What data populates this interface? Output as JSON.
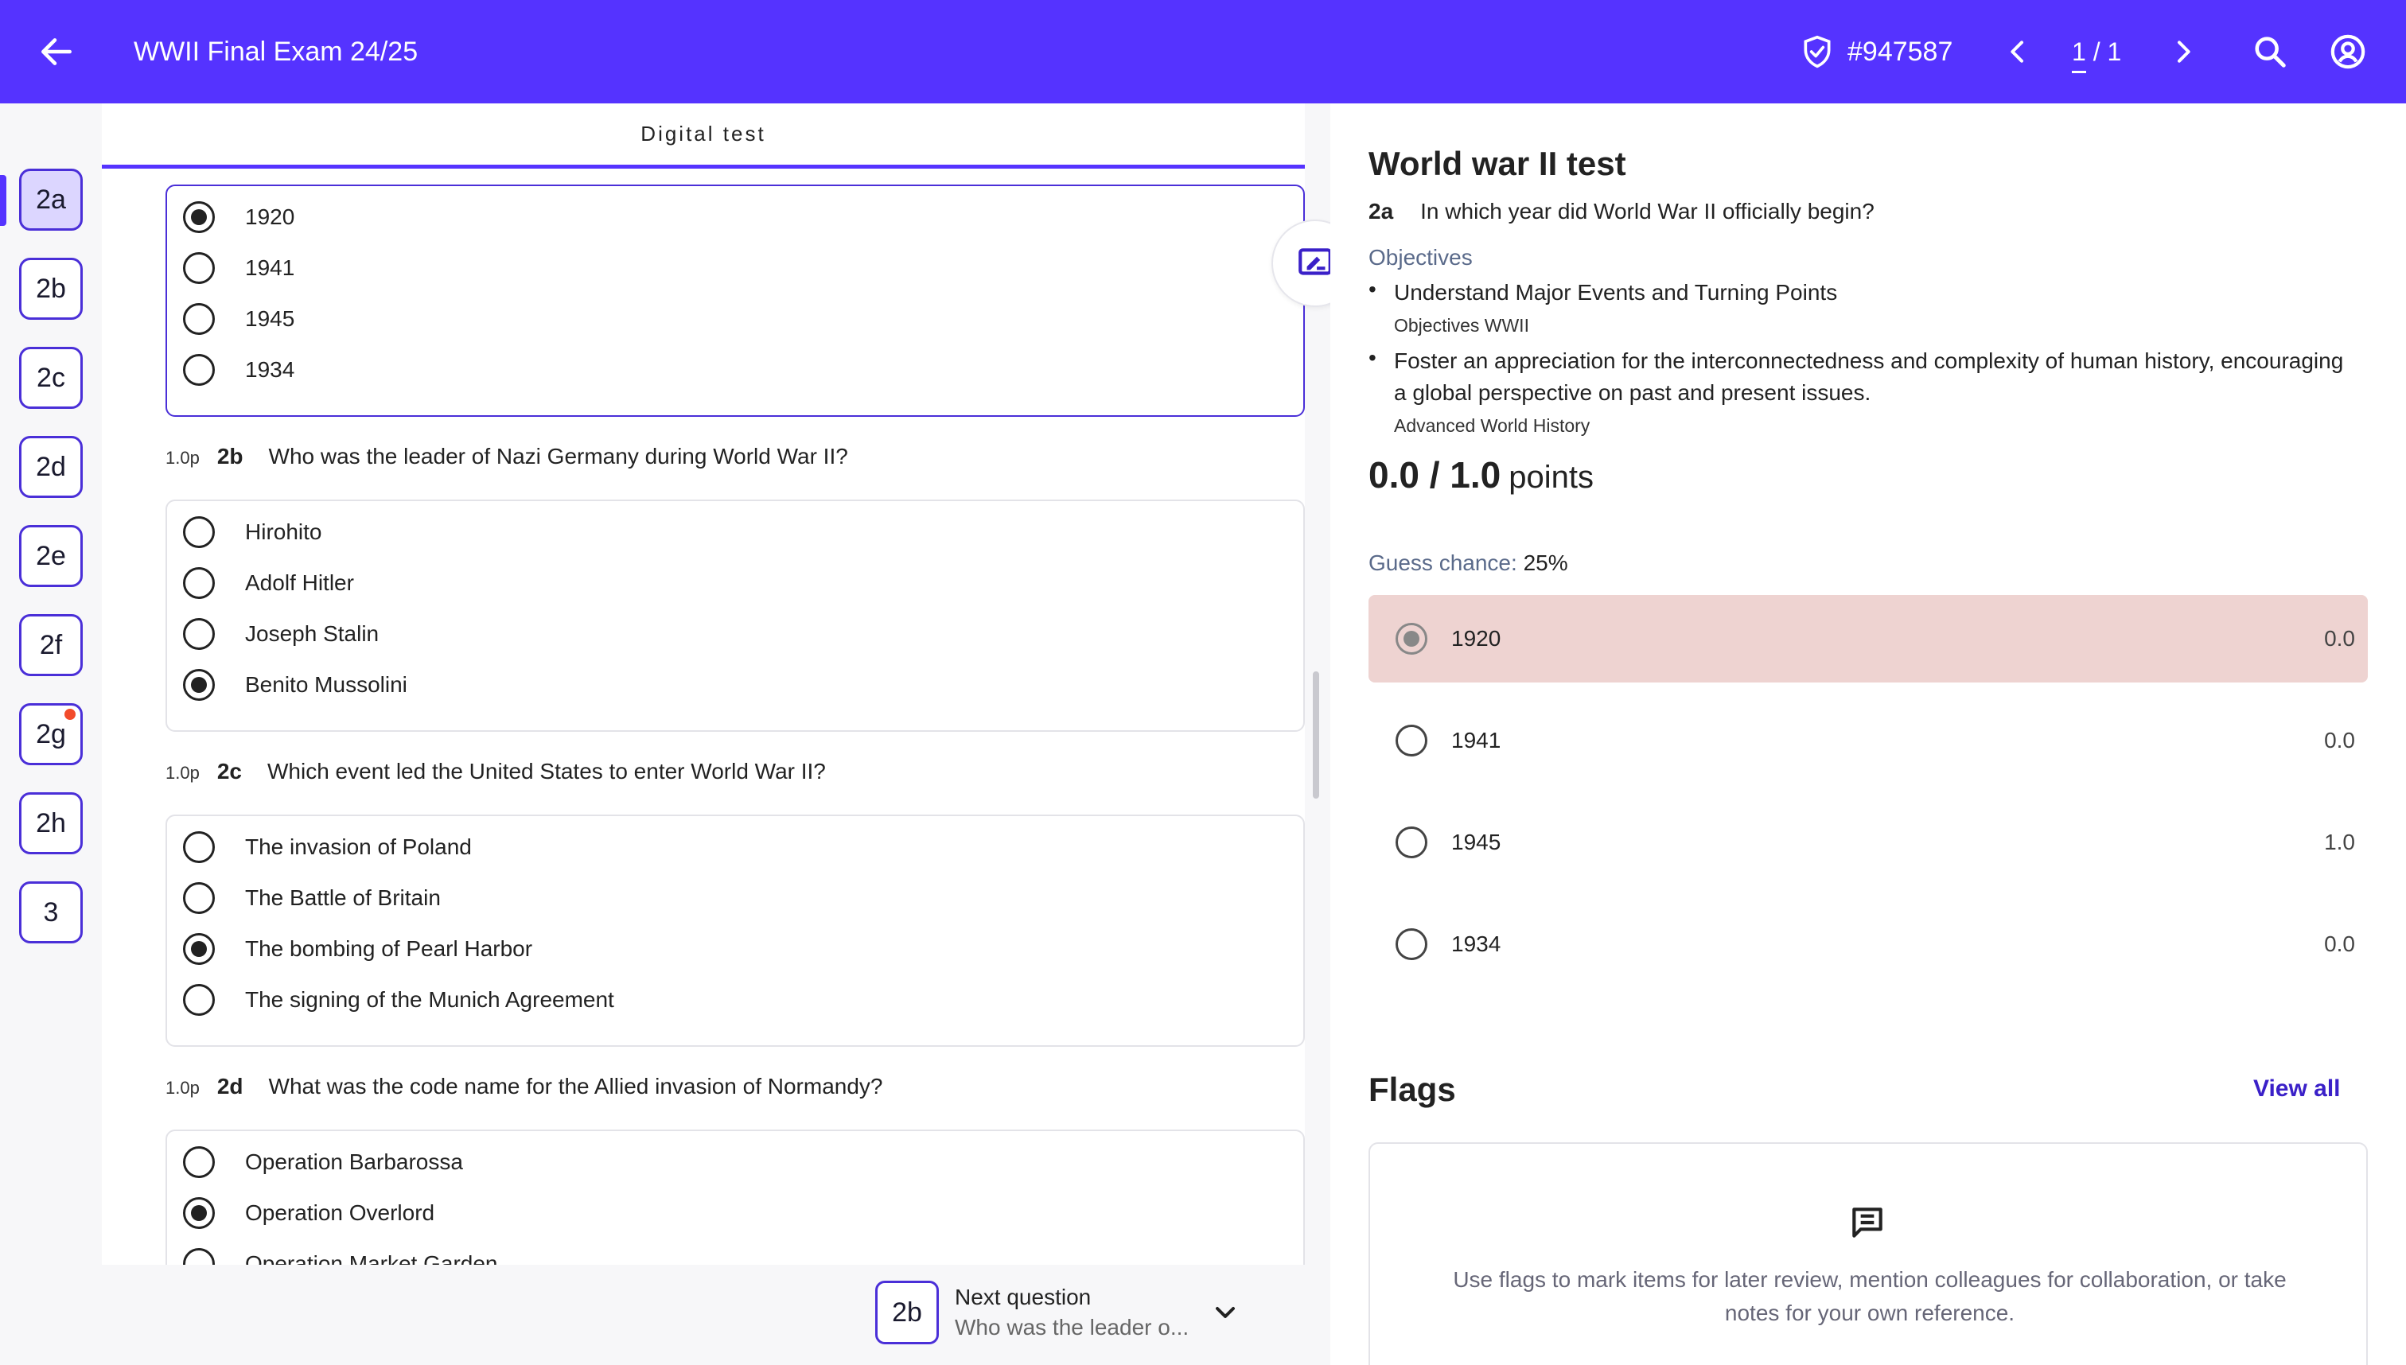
{
  "header": {
    "title": "WWII Final Exam 24/25",
    "ticket_id": "#947587",
    "page_current": "1",
    "page_sep": "/",
    "page_total": "1"
  },
  "left_nav": {
    "items": [
      {
        "label": "2a",
        "active": true
      },
      {
        "label": "2b"
      },
      {
        "label": "2c"
      },
      {
        "label": "2d"
      },
      {
        "label": "2e"
      },
      {
        "label": "2f"
      },
      {
        "label": "2g",
        "flagged": true
      },
      {
        "label": "2h"
      },
      {
        "label": "3"
      }
    ]
  },
  "middle": {
    "tab_title": "Digital test",
    "q2a": {
      "options": [
        "1920",
        "1941",
        "1945",
        "1934"
      ]
    },
    "q2b": {
      "points": "1.0p",
      "num": "2b",
      "text": "Who was the leader of Nazi Germany during World War II?",
      "options": [
        "Hirohito",
        "Adolf Hitler",
        "Joseph Stalin",
        "Benito Mussolini"
      ]
    },
    "q2c": {
      "points": "1.0p",
      "num": "2c",
      "text": "Which event led the United States to enter World War II?",
      "options": [
        "The invasion of Poland",
        "The Battle of Britain",
        "The bombing of Pearl Harbor",
        "The signing of the Munich Agreement"
      ]
    },
    "q2d": {
      "points": "1.0p",
      "num": "2d",
      "text": "What was the code name for the Allied invasion of Normandy?",
      "options": [
        "Operation Barbarossa",
        "Operation Overlord",
        "Operation Market Garden"
      ]
    },
    "next_question": {
      "badge": "2b",
      "label": "Next question",
      "preview": "Who was the leader o..."
    }
  },
  "right": {
    "title": "World war II test",
    "question_num": "2a",
    "question_text": "In which year did World War II officially begin?",
    "objectives_heading": "Objectives",
    "objectives": [
      {
        "text": "Understand Major Events and Turning Points",
        "source": "Objectives WWII"
      },
      {
        "text": "Foster an appreciation for the interconnectedness and complexity of human history, encouraging a global perspective on past and present issues.",
        "source": "Advanced World History"
      }
    ],
    "score": "0.0 / 1.0",
    "score_unit": "points",
    "guess_label": "Guess chance:",
    "guess_value": "25%",
    "answers": [
      {
        "label": "1920",
        "score": "0.0"
      },
      {
        "label": "1941",
        "score": "0.0"
      },
      {
        "label": "1945",
        "score": "1.0"
      },
      {
        "label": "1934",
        "score": "0.0"
      }
    ],
    "flags_heading": "Flags",
    "view_all": "View all",
    "flags_empty": "Use flags to mark items for later review, mention colleagues for collaboration, or take notes for your own reference."
  }
}
